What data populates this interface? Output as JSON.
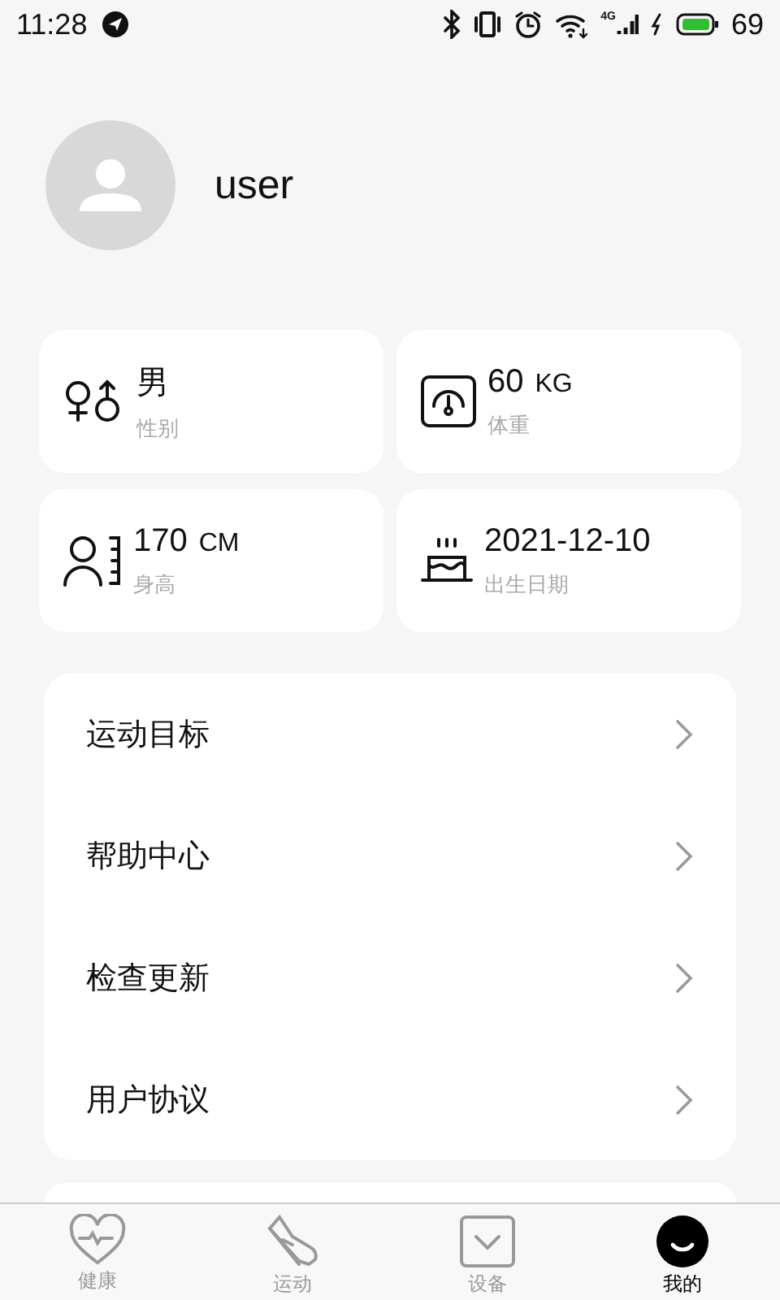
{
  "status_bar": {
    "time": "11:28",
    "network": "4G",
    "battery": "69"
  },
  "profile": {
    "username": "user"
  },
  "stats": [
    {
      "kind": "gender",
      "value": "男",
      "label": "性别"
    },
    {
      "kind": "weight",
      "value": "60",
      "unit": "KG",
      "label": "体重"
    },
    {
      "kind": "height",
      "value": "170",
      "unit": "CM",
      "label": "身高"
    },
    {
      "kind": "birthday",
      "value": "2021-12-10",
      "label": "出生日期"
    }
  ],
  "menu": [
    {
      "label": "运动目标"
    },
    {
      "label": "帮助中心"
    },
    {
      "label": "检查更新"
    },
    {
      "label": "用户协议"
    }
  ],
  "nav": [
    {
      "kind": "health",
      "label": "健康",
      "selected": false
    },
    {
      "kind": "sport",
      "label": "运动",
      "selected": false
    },
    {
      "kind": "device",
      "label": "设备",
      "selected": false
    },
    {
      "kind": "me",
      "label": "我的",
      "selected": true
    }
  ]
}
